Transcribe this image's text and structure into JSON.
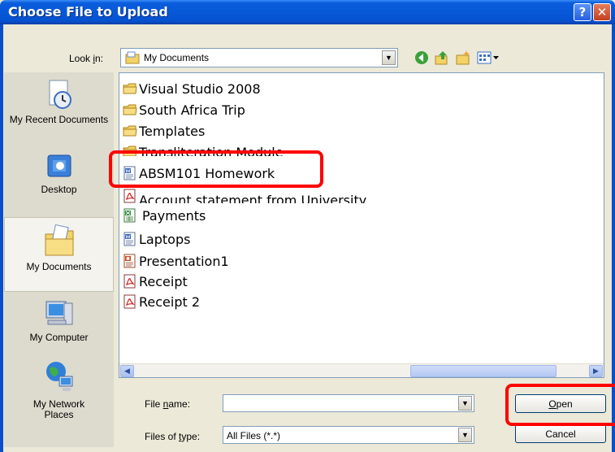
{
  "window": {
    "title": "Choose File to Upload",
    "help_glyph": "?",
    "close_glyph": "✕"
  },
  "lookin": {
    "label_pre": "Look ",
    "label_key": "i",
    "label_post": "n:",
    "value": "My Documents"
  },
  "places": [
    {
      "label": "My Recent Documents",
      "icon": "recent-documents-icon"
    },
    {
      "label": "Desktop",
      "icon": "desktop-icon"
    },
    {
      "label": "My Documents",
      "icon": "my-documents-icon",
      "selected": true
    },
    {
      "label": "My Computer",
      "icon": "my-computer-icon"
    },
    {
      "label": "My Network Places",
      "icon": "network-places-icon"
    }
  ],
  "files": [
    {
      "name": "Visual Studio 2008",
      "type": "folder"
    },
    {
      "name": "South Africa Trip",
      "type": "folder"
    },
    {
      "name": "Templates",
      "type": "folder"
    },
    {
      "name": "Transliteration Module",
      "type": "folder"
    },
    {
      "name": "ABSM101 Homework",
      "type": "word"
    },
    {
      "name": "Account statement from University",
      "type": "pdf"
    },
    {
      "name": "Payments",
      "type": "excel"
    },
    {
      "name": "Laptops",
      "type": "word"
    },
    {
      "name": "Presentation1",
      "type": "powerpoint"
    },
    {
      "name": "Receipt",
      "type": "pdf"
    },
    {
      "name": "Receipt 2",
      "type": "pdf"
    }
  ],
  "filename": {
    "label_pre": "File ",
    "label_key": "n",
    "label_post": "ame:",
    "value": ""
  },
  "filetype": {
    "label_pre": "Files of ",
    "label_key": "t",
    "label_post": "ype:",
    "value": "All Files (*.*)"
  },
  "buttons": {
    "open_key": "O",
    "open_rest": "pen",
    "cancel": "Cancel"
  },
  "colors": {
    "title_bar": "#0758d8",
    "highlight": "#ff0000",
    "folder": "#f3d266"
  }
}
